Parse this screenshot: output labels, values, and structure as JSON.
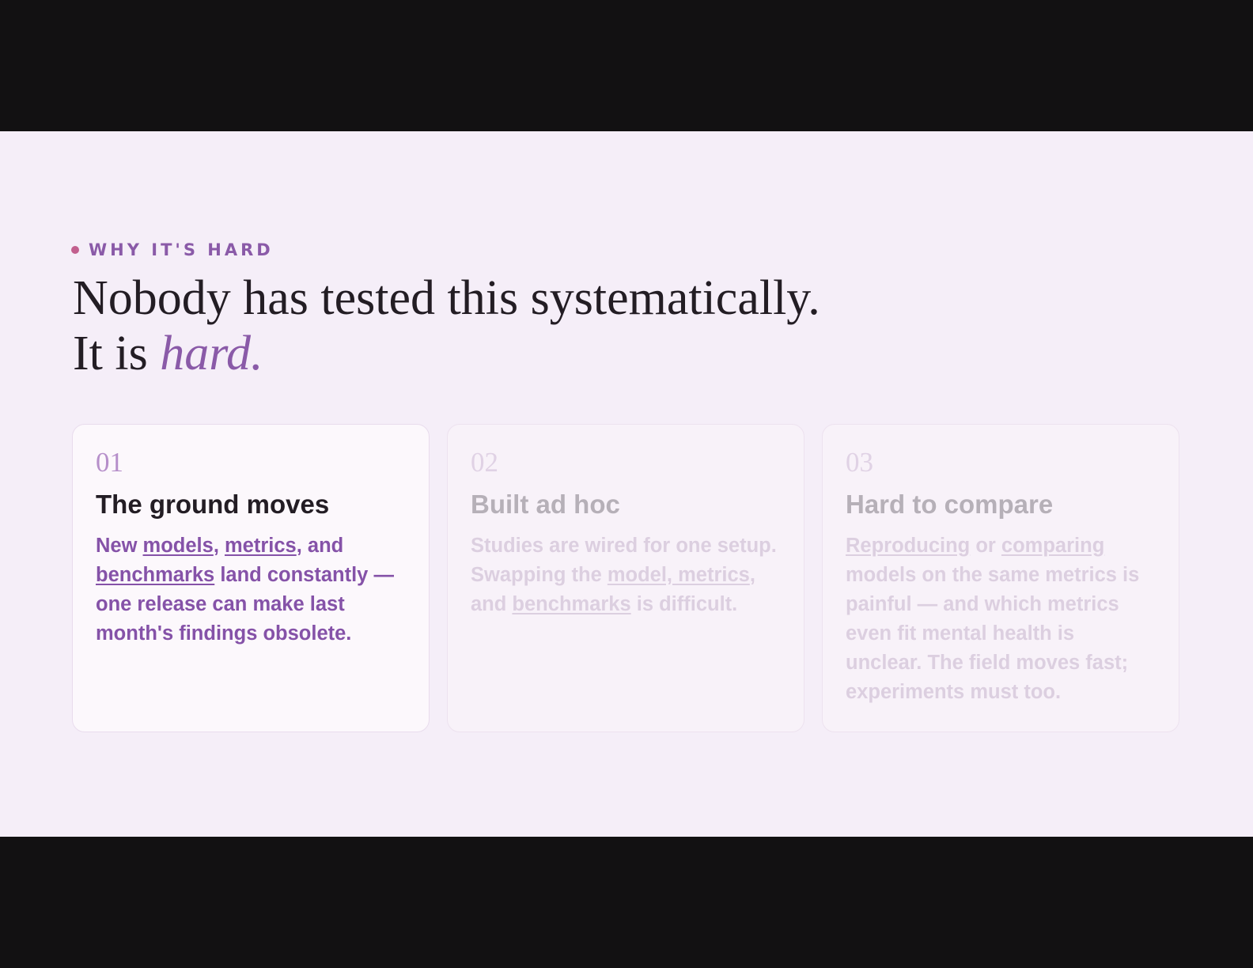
{
  "section": {
    "eyebrow": "WHY IT'S HARD",
    "headline_line1": "Nobody has tested this systematically.",
    "headline_line2_prefix": "It is",
    "headline_line2_accent": "hard."
  },
  "cards": [
    {
      "number": "01",
      "title": "The ground moves",
      "active": true,
      "body": [
        {
          "text": "New "
        },
        {
          "text": "models",
          "link": true
        },
        {
          "text": ", "
        },
        {
          "text": "metrics",
          "link": true
        },
        {
          "text": ", and "
        },
        {
          "text": "benchmarks",
          "link": true
        },
        {
          "text": " land constantly — one release can make last month's findings obsolete."
        }
      ]
    },
    {
      "number": "02",
      "title": "Built ad hoc",
      "active": false,
      "body": [
        {
          "text": "Studies are wired for one setup. Swapping the "
        },
        {
          "text": "model, metrics",
          "link": true
        },
        {
          "text": ", and "
        },
        {
          "text": "benchmarks",
          "link": true
        },
        {
          "text": " is difficult."
        }
      ]
    },
    {
      "number": "03",
      "title": "Hard to compare",
      "active": false,
      "body": [
        {
          "text": "Reproducing",
          "link": true
        },
        {
          "text": " or "
        },
        {
          "text": "comparing",
          "link": true
        },
        {
          "text": " models on the same metrics is painful — and which metrics even fit mental health is unclear. The field moves fast; experiments must too."
        }
      ]
    }
  ],
  "colors": {
    "accent": "#8a5aa8",
    "dot": "#c25f8e",
    "text_dark": "#231d24",
    "slide_bg": "#f5eef8",
    "frame_bg": "#121112"
  }
}
